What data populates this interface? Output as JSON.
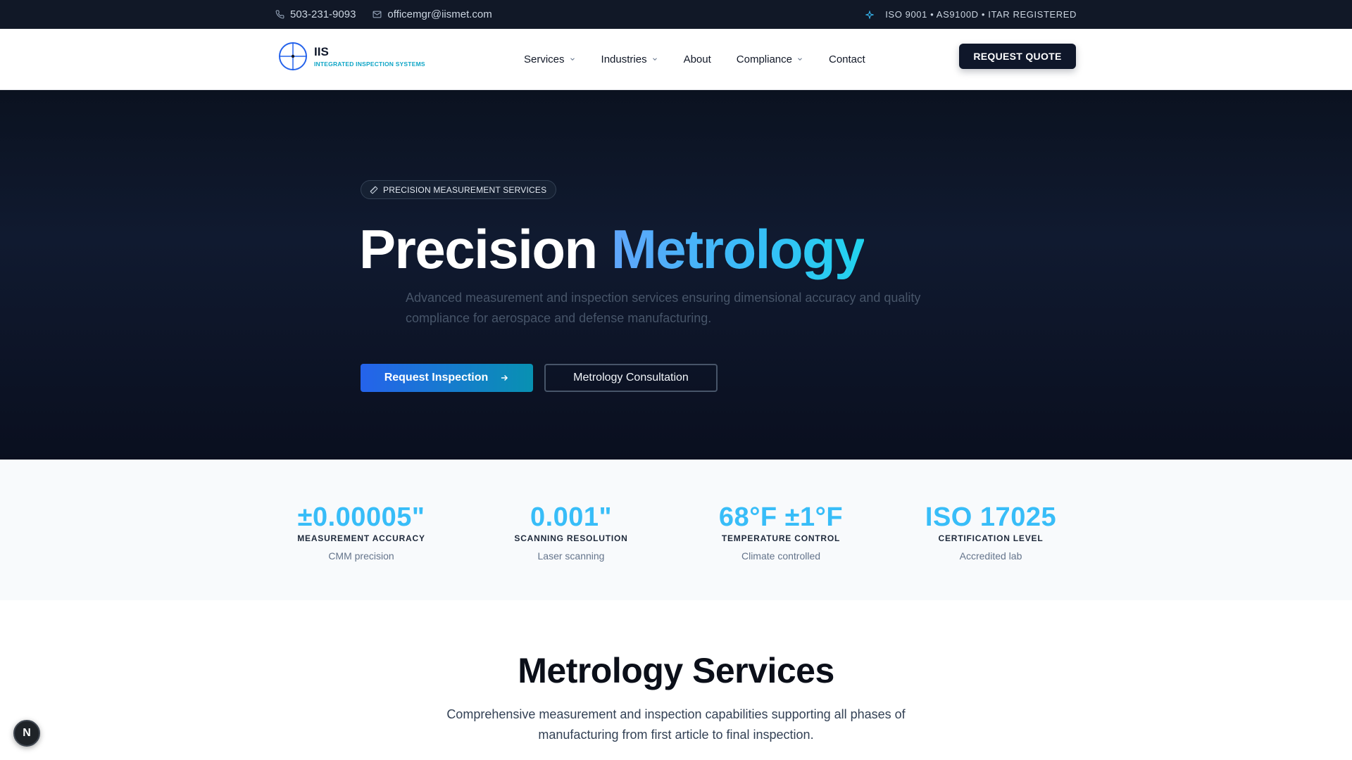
{
  "topbar": {
    "phone": "503-231-9093",
    "email": "officemgr@iismet.com",
    "certifications": "ISO 9001 • AS9100D • ITAR REGISTERED"
  },
  "nav": {
    "logo_abbr": "IIS",
    "logo_full": "INTEGRATED INSPECTION SYSTEMS",
    "items": [
      {
        "label": "Services",
        "dropdown": true
      },
      {
        "label": "Industries",
        "dropdown": true
      },
      {
        "label": "About",
        "dropdown": false
      },
      {
        "label": "Compliance",
        "dropdown": true
      },
      {
        "label": "Contact",
        "dropdown": false
      }
    ],
    "cta": "REQUEST QUOTE"
  },
  "hero": {
    "badge": "PRECISION MEASUREMENT SERVICES",
    "title_plain": "Precision",
    "title_accent": "Metrology",
    "subtitle": "Advanced measurement and inspection services ensuring dimensional accuracy and quality compliance for aerospace and defense manufacturing.",
    "primary_button": "Request Inspection",
    "secondary_button": "Metrology Consultation"
  },
  "stats": [
    {
      "value": "±0.00005\"",
      "label": "MEASUREMENT ACCURACY",
      "note": "CMM precision"
    },
    {
      "value": "0.001\"",
      "label": "SCANNING RESOLUTION",
      "note": "Laser scanning"
    },
    {
      "value": "68°F ±1°F",
      "label": "TEMPERATURE CONTROL",
      "note": "Climate controlled"
    },
    {
      "value": "ISO 17025",
      "label": "CERTIFICATION LEVEL",
      "note": "Accredited lab"
    }
  ],
  "services": {
    "title": "Metrology Services",
    "description": "Comprehensive measurement and inspection capabilities supporting all phases of manufacturing from first article to final inspection."
  },
  "dev_badge": "N",
  "colors": {
    "topbar_bg": "#111827",
    "hero_bg": "#0b1220",
    "accent_cyan": "#38bdf8",
    "primary_blue": "#2563eb",
    "cta_dark": "#0f172a"
  },
  "icons": [
    "phone-icon",
    "mail-icon",
    "sparkle-icon",
    "crosshair-logo-icon",
    "chevron-down-icon",
    "ruler-icon",
    "arrow-right-icon"
  ]
}
